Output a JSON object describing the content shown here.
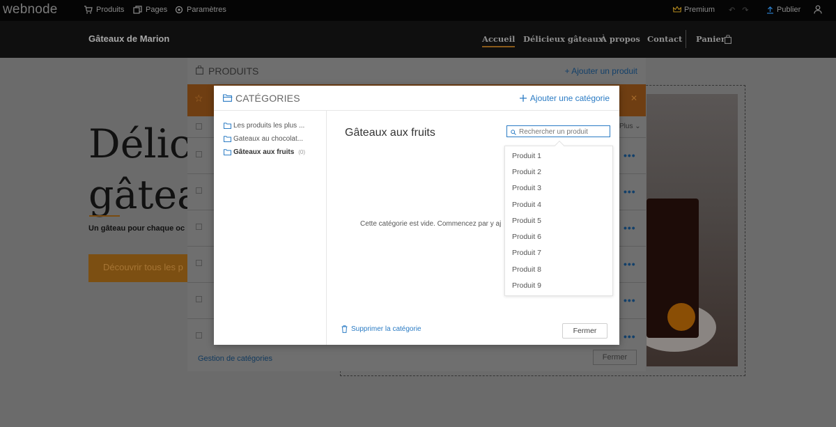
{
  "topbar": {
    "logo": "webnode",
    "nav": [
      {
        "label": "Produits",
        "icon": "cart-icon"
      },
      {
        "label": "Pages",
        "icon": "pages-icon"
      },
      {
        "label": "Paramètres",
        "icon": "gear-icon"
      }
    ],
    "premium": "Premium",
    "publish": "Publier"
  },
  "site": {
    "title": "Gâteaux de Marion",
    "nav": [
      "Accueil",
      "Délicieux gâteaux",
      "À propos",
      "Contact",
      "Panier"
    ],
    "hero_line1": "Délici",
    "hero_line2": "gâteau",
    "hero_sub": "Un gâteau pour chaque oc",
    "hero_button": "Découvrir tous les p"
  },
  "products_panel": {
    "title": "PRODUITS",
    "add": "Ajouter un produit",
    "plus": "Plus",
    "manage_categories": "Gestion de catégories",
    "close": "Fermer"
  },
  "modal": {
    "title": "CATÉGORIES",
    "add_category": "Ajouter une catégorie",
    "categories": [
      {
        "label": "Les produits les plus ...",
        "count": ""
      },
      {
        "label": "Gateaux au chocolat...",
        "count": ""
      },
      {
        "label": "Gâteaux aux fruits",
        "count": "(0)"
      }
    ],
    "heading": "Gâteaux aux fruits",
    "search_placeholder": "Rechercher un produit",
    "dropdown": [
      "Produit 1",
      "Produit 2",
      "Produit 3",
      "Produit 4",
      "Produit 5",
      "Produit 6",
      "Produit 7",
      "Produit 8",
      "Produit 9"
    ],
    "empty": "Cette catégorie est vide. Commencez par y aj",
    "delete": "Supprimer la catégorie",
    "close": "Fermer"
  },
  "colors": {
    "accent_blue": "#2a7bc4",
    "brand_orange": "#c97a1c"
  }
}
